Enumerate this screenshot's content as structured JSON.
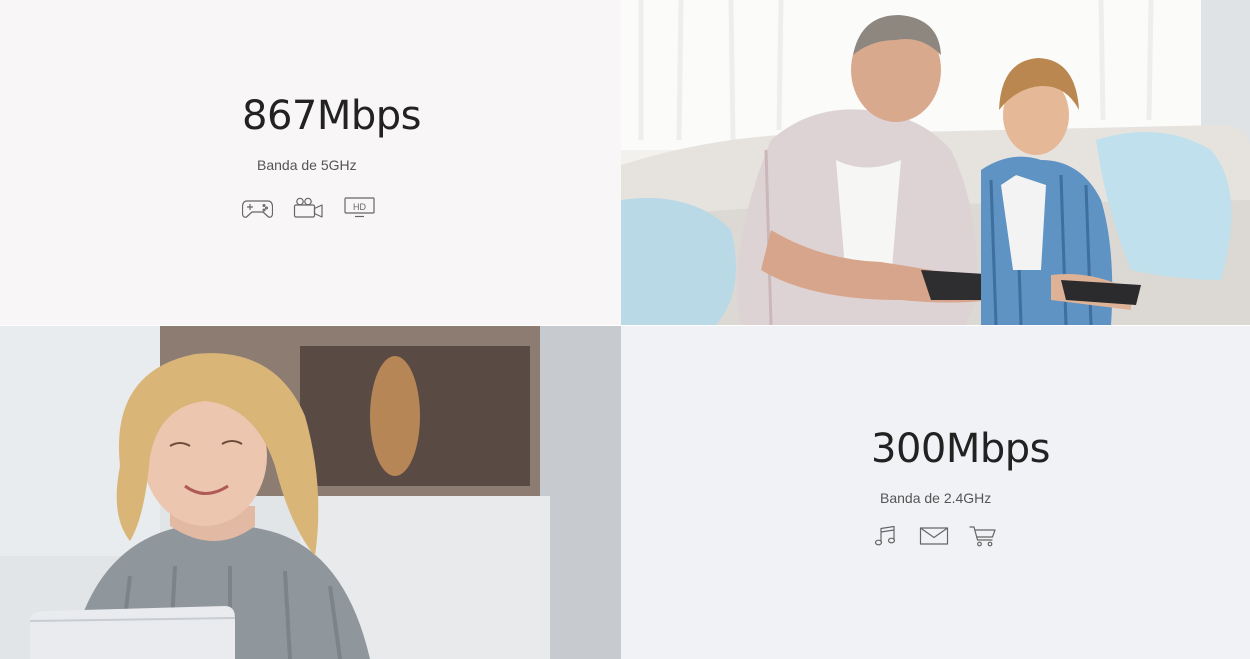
{
  "band_5ghz": {
    "speed": "867Mbps",
    "band_label": "Banda de 5GHz",
    "icons": [
      "gamepad-icon",
      "video-camera-icon",
      "hd-tv-icon"
    ],
    "hd_badge_text": "HD"
  },
  "band_24ghz": {
    "speed": "300Mbps",
    "band_label": "Banda de 2.4GHz",
    "icons": [
      "music-note-icon",
      "mail-envelope-icon",
      "shopping-cart-icon"
    ]
  },
  "photos": {
    "gaming": "father-and-son-gaming-photo",
    "laptop": "woman-using-laptop-photo"
  },
  "colors": {
    "text_dark": "#222222",
    "text_muted": "#555555",
    "icon_stroke": "#666666",
    "panel_light": "#f8f6f6",
    "panel_cool": "#f1f2f5"
  }
}
